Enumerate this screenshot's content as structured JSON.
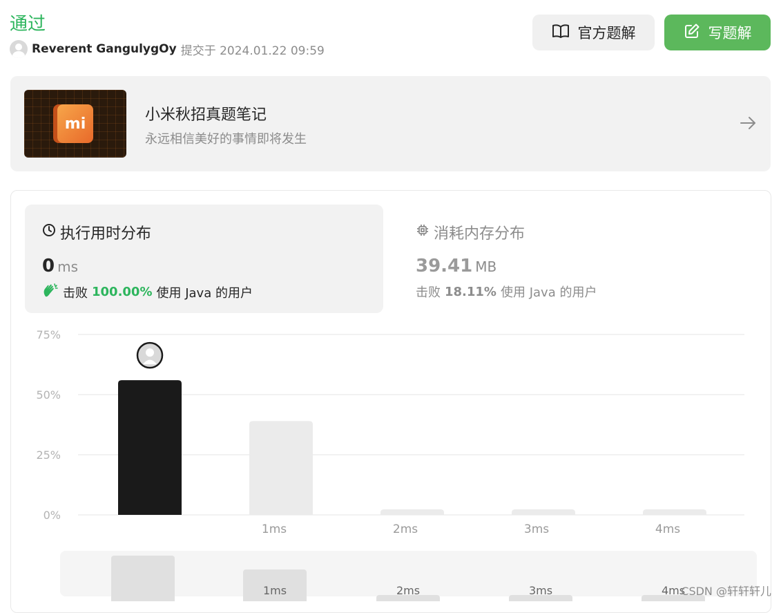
{
  "header": {
    "status": "通过",
    "user_name": "Reverent GangulygOy",
    "submitted_label": "提交于 2024.01.22 09:59"
  },
  "actions": {
    "official_solution": "官方题解",
    "write_solution": "写题解"
  },
  "banner": {
    "title": "小米秋招真题笔记",
    "subtitle": "永远相信美好的事情即将发生",
    "logo_text": "mi"
  },
  "runtime_tab": {
    "title": "执行用时分布",
    "value": "0",
    "unit": "ms",
    "beat_prefix": "击败",
    "beat_percent": "100.00%",
    "beat_suffix": "使用 Java 的用户"
  },
  "memory_tab": {
    "title": "消耗内存分布",
    "value": "39.41",
    "unit": "MB",
    "beat_prefix": "击败",
    "beat_percent": "18.11%",
    "beat_suffix": "使用 Java 的用户"
  },
  "chart_data": {
    "type": "bar",
    "y_ticks": [
      "75%",
      "50%",
      "25%",
      "0%"
    ],
    "ylim": [
      0,
      75
    ],
    "categories": [
      "",
      "1ms",
      "2ms",
      "3ms",
      "4ms"
    ],
    "values": [
      56,
      39,
      2,
      2,
      2
    ],
    "highlight_index": 0,
    "highlight_color": "#1a1a1a",
    "bar_color": "#ebebeb"
  },
  "overview_chart": {
    "labels": [
      "",
      "1ms",
      "2ms",
      "3ms",
      "4ms"
    ],
    "values": [
      56,
      39,
      2,
      2,
      2
    ]
  },
  "watermark": "CSDN @轩轩轩儿"
}
